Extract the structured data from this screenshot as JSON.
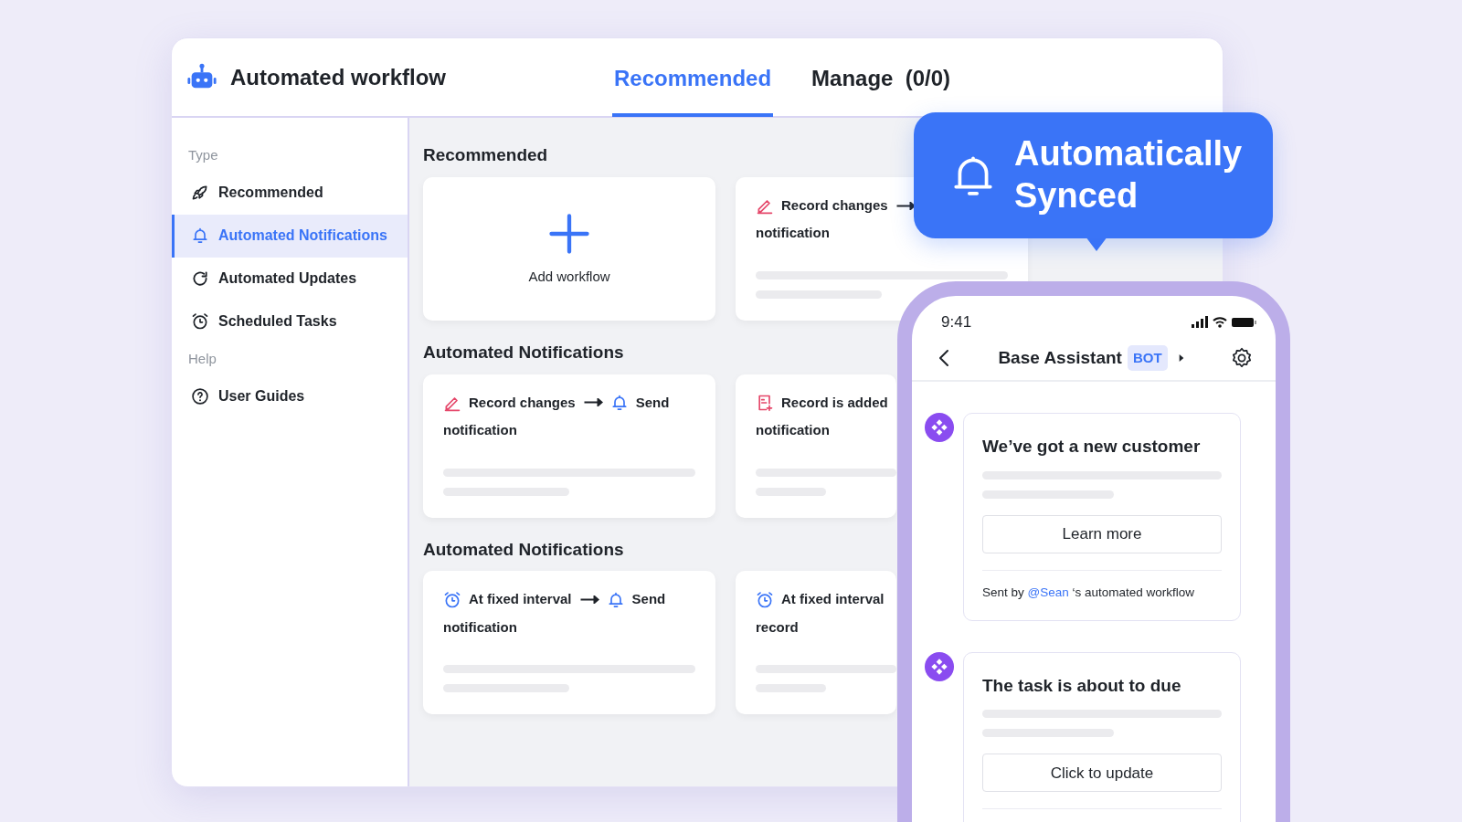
{
  "app": {
    "title": "Automated workflow"
  },
  "tabs": [
    {
      "label": "Recommended",
      "selected": true
    },
    {
      "label": "Manage  (0/0)",
      "selected": false
    }
  ],
  "sidebar": {
    "sections": [
      {
        "heading": "Type",
        "items": [
          {
            "label": "Recommended",
            "selected": false
          },
          {
            "label": "Automated Notifications",
            "selected": true
          },
          {
            "label": "Automated Updates",
            "selected": false
          },
          {
            "label": "Scheduled Tasks",
            "selected": false
          }
        ]
      },
      {
        "heading": "Help",
        "items": [
          {
            "label": "User Guides",
            "selected": false
          }
        ]
      }
    ]
  },
  "sections": [
    {
      "title": "Recommended",
      "cards": [
        {
          "kind": "add",
          "label": "Add workflow"
        },
        {
          "kind": "flow",
          "trigger": {
            "kind": "edit",
            "text": "Record changes"
          },
          "arrow": true,
          "second_line": "notification"
        }
      ]
    },
    {
      "title": "Automated Notifications",
      "cards": [
        {
          "kind": "flow",
          "trigger": {
            "kind": "edit",
            "text": "Record changes"
          },
          "arrow": true,
          "action": "Send",
          "second_line": "notification"
        },
        {
          "kind": "flow",
          "trigger": {
            "kind": "add",
            "text": "Record is added"
          },
          "arrow": false,
          "second_line": "notification"
        }
      ]
    },
    {
      "title": "Automated Notifications",
      "cards": [
        {
          "kind": "flow",
          "trigger": {
            "kind": "timer",
            "text": "At fixed interval"
          },
          "arrow": true,
          "action": "Send",
          "second_line": "notification"
        },
        {
          "kind": "flow",
          "trigger": {
            "kind": "timer",
            "text": "At fixed interval"
          },
          "arrow": false,
          "second_line": "record"
        }
      ]
    }
  ],
  "banner": {
    "text": "Automatically Synced"
  },
  "phone": {
    "time": "9:41",
    "title": "Base Assistant",
    "badge": "BOT",
    "messages": [
      {
        "title": "We’ve got a new customer",
        "button": "Learn more",
        "footer": {
          "before": "Sent by",
          "mention": "@Sean",
          "after": "‘s automated workflow"
        }
      },
      {
        "title": "The task is about to due",
        "button": "Click to update"
      }
    ]
  }
}
